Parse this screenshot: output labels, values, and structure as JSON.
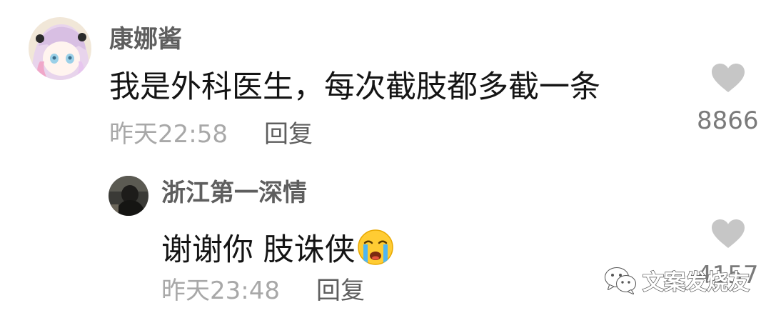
{
  "comment": {
    "username": "康娜酱",
    "text": "我是外科医生，每次截肢都多截一条",
    "time": "昨天22:58",
    "reply_label": "回复",
    "like_count": "8866",
    "avatar_icon": "anime-girl-avatar"
  },
  "reply": {
    "username": "浙江第一深情",
    "text": "谢谢你 肢诛侠",
    "emoji_icon": "crying-face-emoji",
    "time": "昨天23:48",
    "reply_label": "回复",
    "like_count": "4157",
    "avatar_icon": "dark-photo-avatar"
  },
  "watermark": {
    "text": "文案发烧友",
    "icon": "wechat-icon"
  },
  "colors": {
    "username": "#5e5e5e",
    "text": "#141414",
    "meta": "#a8a8a8",
    "like_icon": "#c6c6c6"
  }
}
